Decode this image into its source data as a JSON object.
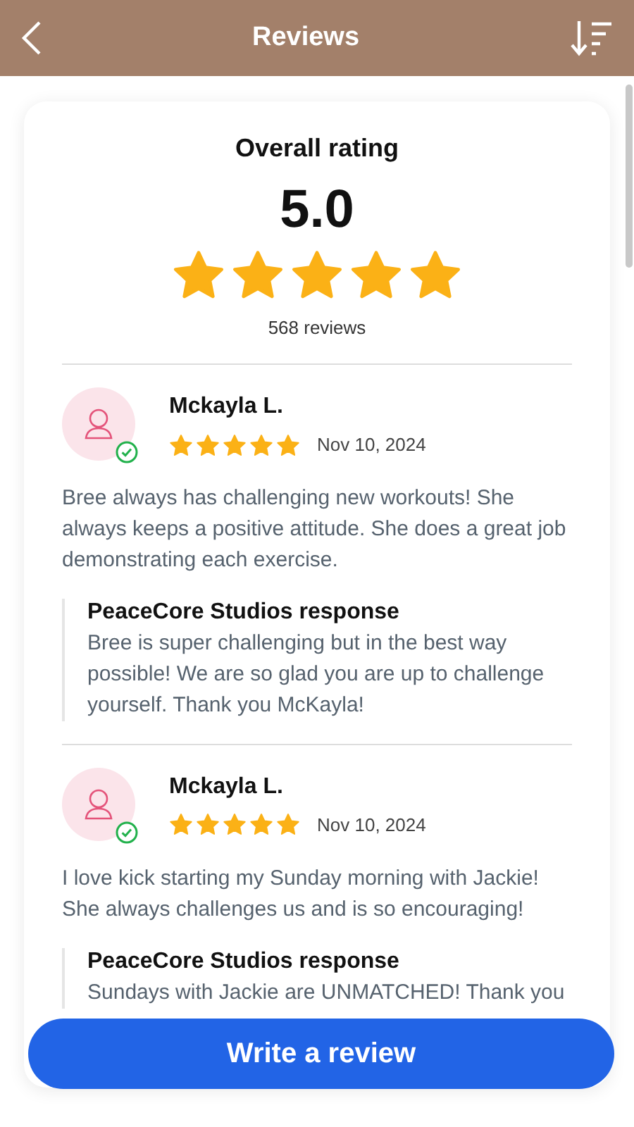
{
  "header": {
    "title": "Reviews"
  },
  "summary": {
    "title": "Overall rating",
    "score": "5.0",
    "stars": 5,
    "count": "568 reviews"
  },
  "reviews": [
    {
      "name": "Mckayla L.",
      "verified": true,
      "stars": 5,
      "date": "Nov 10, 2024",
      "text": "Bree always has challenging new workouts! She always keeps a positive attitude. She does a great job demonstrating each exercise.",
      "response": {
        "title": "PeaceCore Studios response",
        "text": "Bree is super challenging but in the best way possible! We are so glad you are up to challenge yourself. Thank you McKayla!"
      }
    },
    {
      "name": "Mckayla L.",
      "verified": true,
      "stars": 5,
      "date": "Nov 10, 2024",
      "text": "I love kick starting my Sunday morning with Jackie! She always challenges us and is so encouraging!",
      "response": {
        "title": "PeaceCore Studios response",
        "text": "Sundays with Jackie are UNMATCHED! Thank you"
      }
    }
  ],
  "write_button": "Write a review"
}
